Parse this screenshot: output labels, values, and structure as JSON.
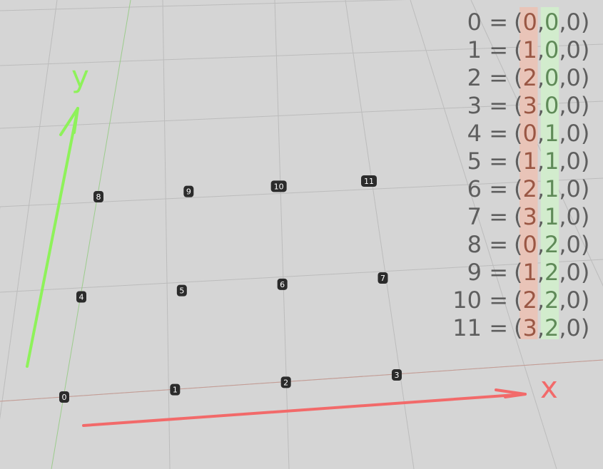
{
  "colors": {
    "background": "#d5d5d5",
    "x_axis": "#f26a6a",
    "y_axis": "#8ef25a",
    "x_highlight": "#e9c4b8",
    "y_highlight": "#d2eccd",
    "x_digit": "#9a5744",
    "y_digit": "#5f8a58",
    "table_text": "#5e5e5e",
    "badge": "#2b2b2b"
  },
  "axis_labels": {
    "x": "x",
    "y": "y"
  },
  "points": [
    {
      "index": "0",
      "x": 0,
      "y": 0,
      "z": 0
    },
    {
      "index": "1",
      "x": 1,
      "y": 0,
      "z": 0
    },
    {
      "index": "2",
      "x": 2,
      "y": 0,
      "z": 0
    },
    {
      "index": "3",
      "x": 3,
      "y": 0,
      "z": 0
    },
    {
      "index": "4",
      "x": 0,
      "y": 1,
      "z": 0
    },
    {
      "index": "5",
      "x": 1,
      "y": 1,
      "z": 0
    },
    {
      "index": "6",
      "x": 2,
      "y": 1,
      "z": 0
    },
    {
      "index": "7",
      "x": 3,
      "y": 1,
      "z": 0
    },
    {
      "index": "8",
      "x": 0,
      "y": 2,
      "z": 0
    },
    {
      "index": "9",
      "x": 1,
      "y": 2,
      "z": 0
    },
    {
      "index": "10",
      "x": 2,
      "y": 2,
      "z": 0
    },
    {
      "index": "11",
      "x": 3,
      "y": 2,
      "z": 0
    }
  ]
}
